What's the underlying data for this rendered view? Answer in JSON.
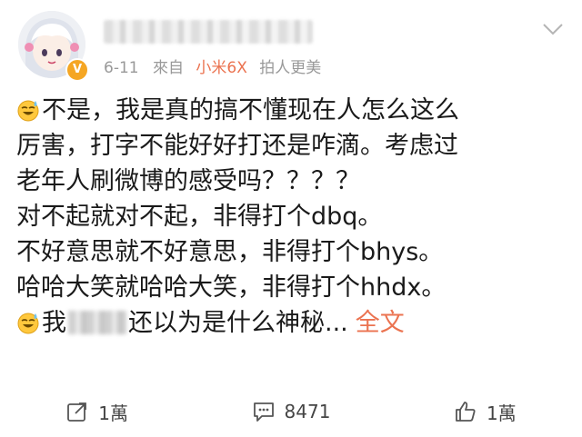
{
  "post": {
    "date": "6-11",
    "from_label": "來自",
    "device": "小米6X",
    "device_tagline": "拍人更美",
    "lines": [
      "不是，我是真的搞不懂现在人怎么这么",
      "厉害，打字不能好好打还是咋滴。考虑过",
      "老年人刷微博的感受吗？？？？",
      "对不起就对不起，非得打个dbq。",
      "不好意思就不好意思，非得打个bhys。",
      "哈哈大笑就哈哈大笑，非得打个hhdx。"
    ],
    "last_line_start": "我",
    "last_line_end": "还以为是什么神秘...",
    "full_text_link": "全文"
  },
  "actions": {
    "share_count": "1萬",
    "comment_count": "8471",
    "like_count": "1萬"
  },
  "icons": {
    "emoji": "sweat-smile-icon",
    "share": "share-icon",
    "comment": "comment-icon",
    "like": "thumbs-up-icon",
    "menu": "chevron-down-icon",
    "verified": "verified-badge-icon"
  },
  "colors": {
    "accent": "#eb7350",
    "meta_text": "#999999",
    "verified": "#f5a623"
  }
}
